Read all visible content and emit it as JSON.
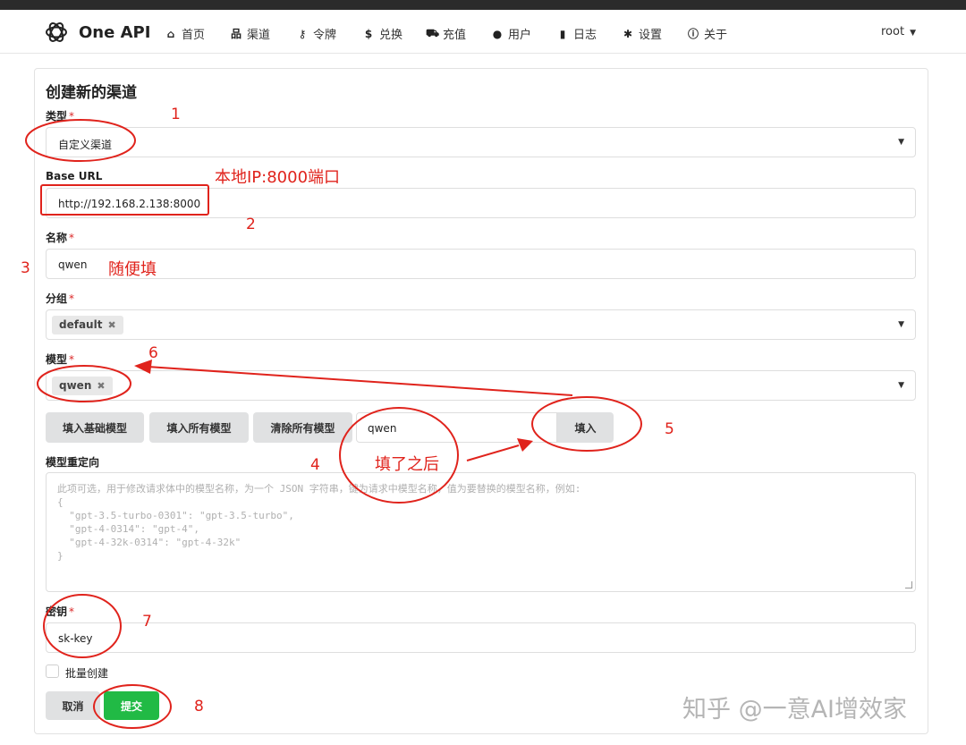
{
  "app": {
    "name": "One API"
  },
  "nav": {
    "items": [
      {
        "label": "首页",
        "icon": "home-icon"
      },
      {
        "label": "渠道",
        "icon": "sitemap-icon"
      },
      {
        "label": "令牌",
        "icon": "key-icon"
      },
      {
        "label": "兑换",
        "icon": "dollar-icon"
      },
      {
        "label": "充值",
        "icon": "cart-icon"
      },
      {
        "label": "用户",
        "icon": "user-icon"
      },
      {
        "label": "日志",
        "icon": "book-icon"
      },
      {
        "label": "设置",
        "icon": "gear-icon"
      },
      {
        "label": "关于",
        "icon": "info-icon"
      }
    ],
    "user": "root"
  },
  "form": {
    "title": "创建新的渠道",
    "type": {
      "label": "类型",
      "value": "自定义渠道"
    },
    "base_url": {
      "label": "Base URL",
      "value": "http://192.168.2.138:8000"
    },
    "name": {
      "label": "名称",
      "value": "qwen"
    },
    "group": {
      "label": "分组",
      "chip": "default"
    },
    "models": {
      "label": "模型",
      "chip": "qwen"
    },
    "model_buttons": {
      "fill_basic": "填入基础模型",
      "fill_all": "填入所有模型",
      "clear_all": "清除所有模型",
      "custom_value": "qwen",
      "fill": "填入"
    },
    "model_mapping": {
      "label": "模型重定向",
      "placeholder": "此项可选，用于修改请求体中的模型名称，为一个 JSON 字符串，键为请求中模型名称，值为要替换的模型名称，例如:\n{\n  \"gpt-3.5-turbo-0301\": \"gpt-3.5-turbo\",\n  \"gpt-4-0314\": \"gpt-4\",\n  \"gpt-4-32k-0314\": \"gpt-4-32k\"\n}"
    },
    "key": {
      "label": "密钥",
      "value": "sk-key"
    },
    "batch_create": "批量创建",
    "cancel": "取消",
    "submit": "提交"
  },
  "annotations": {
    "n1": "1",
    "local_ip": "本地IP:8000端口",
    "n2": "2",
    "n3": "3",
    "casual_fill": "随便填",
    "n6": "6",
    "n5": "5",
    "n4": "4",
    "after_fill": "填了之后",
    "n7": "7",
    "n8": "8"
  },
  "watermark": "知乎 @一意AI增效家",
  "colors": {
    "annotation": "#e0231c",
    "submit": "#21ba45",
    "required": "#db2828"
  }
}
